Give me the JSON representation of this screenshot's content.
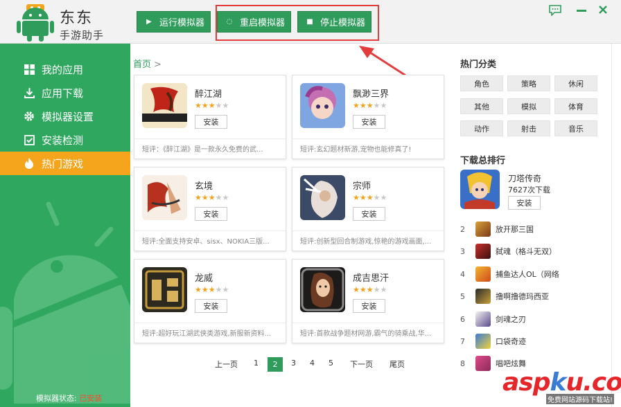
{
  "app": {
    "brand_line1": "东东",
    "brand_line2": "手游助手"
  },
  "toolbar": {
    "run_label": "运行模拟器",
    "restart_label": "重启模拟器",
    "stop_label": "停止模拟器"
  },
  "sidebar": {
    "items": [
      {
        "label": "我的应用",
        "icon": "grid-icon"
      },
      {
        "label": "应用下载",
        "icon": "download-icon"
      },
      {
        "label": "模拟器设置",
        "icon": "gear-icon"
      },
      {
        "label": "安装检测",
        "icon": "checkbox-icon"
      },
      {
        "label": "热门游戏",
        "icon": "fire-icon"
      }
    ],
    "active_index": 4,
    "status_label": "模拟器状态:",
    "status_value": "已安装"
  },
  "breadcrumb": {
    "home": "首页",
    "sep": ">"
  },
  "games": [
    {
      "name": "醉江湖",
      "rating": 3,
      "install": "安装",
      "desc": "短评：《醉江湖》是一款永久免费的武..."
    },
    {
      "name": "飘渺三界",
      "rating": 3,
      "install": "安装",
      "desc": "短评:玄幻题材新游,宠物也能修真了!"
    },
    {
      "name": "玄境",
      "rating": 3,
      "install": "安装",
      "desc": "短评:全面支持安卓、sisx、NOKIA三版..."
    },
    {
      "name": "宗师",
      "rating": 3,
      "install": "安装",
      "desc": "短评:创新型回合制游戏,惊艳的游戏画面,..."
    },
    {
      "name": "龙威",
      "rating": 3,
      "install": "安装",
      "desc": "短评:超好玩江湖武侠类游戏,新服新资料..."
    },
    {
      "name": "成吉思汗",
      "rating": 3,
      "install": "安装",
      "desc": "短评:首款战争题材网游,霸气的骑乘战,华..."
    }
  ],
  "pagination": {
    "prev": "上一页",
    "pages": [
      "1",
      "2",
      "3",
      "4",
      "5"
    ],
    "active": "2",
    "next": "下一页",
    "last": "尾页"
  },
  "hot_categories": {
    "title": "热门分类",
    "tags": [
      "角色",
      "策略",
      "休闲",
      "其他",
      "模拟",
      "体育",
      "动作",
      "射击",
      "音乐"
    ]
  },
  "ranking": {
    "title": "下载总排行",
    "top": {
      "name": "刀塔传奇",
      "count": "7627次下载",
      "install": "安装"
    },
    "items": [
      {
        "num": "2",
        "name": "放开那三国"
      },
      {
        "num": "3",
        "name": "弑魂（格斗无双）"
      },
      {
        "num": "4",
        "name": "捕鱼达人OL（网络"
      },
      {
        "num": "5",
        "name": "撸啊撸德玛西亚"
      },
      {
        "num": "6",
        "name": "剑魂之刃"
      },
      {
        "num": "7",
        "name": "口袋奇迹"
      },
      {
        "num": "8",
        "name": "唱吧炫舞"
      }
    ]
  },
  "watermark": {
    "text_a": "asp",
    "text_k": "k",
    "text_b": "u.com",
    "sub": "免费网站源码下载站!"
  },
  "colors": {
    "accent_green": "#2f9c5b",
    "active_orange": "#f4a51c",
    "highlight_red": "#e23c3c"
  }
}
